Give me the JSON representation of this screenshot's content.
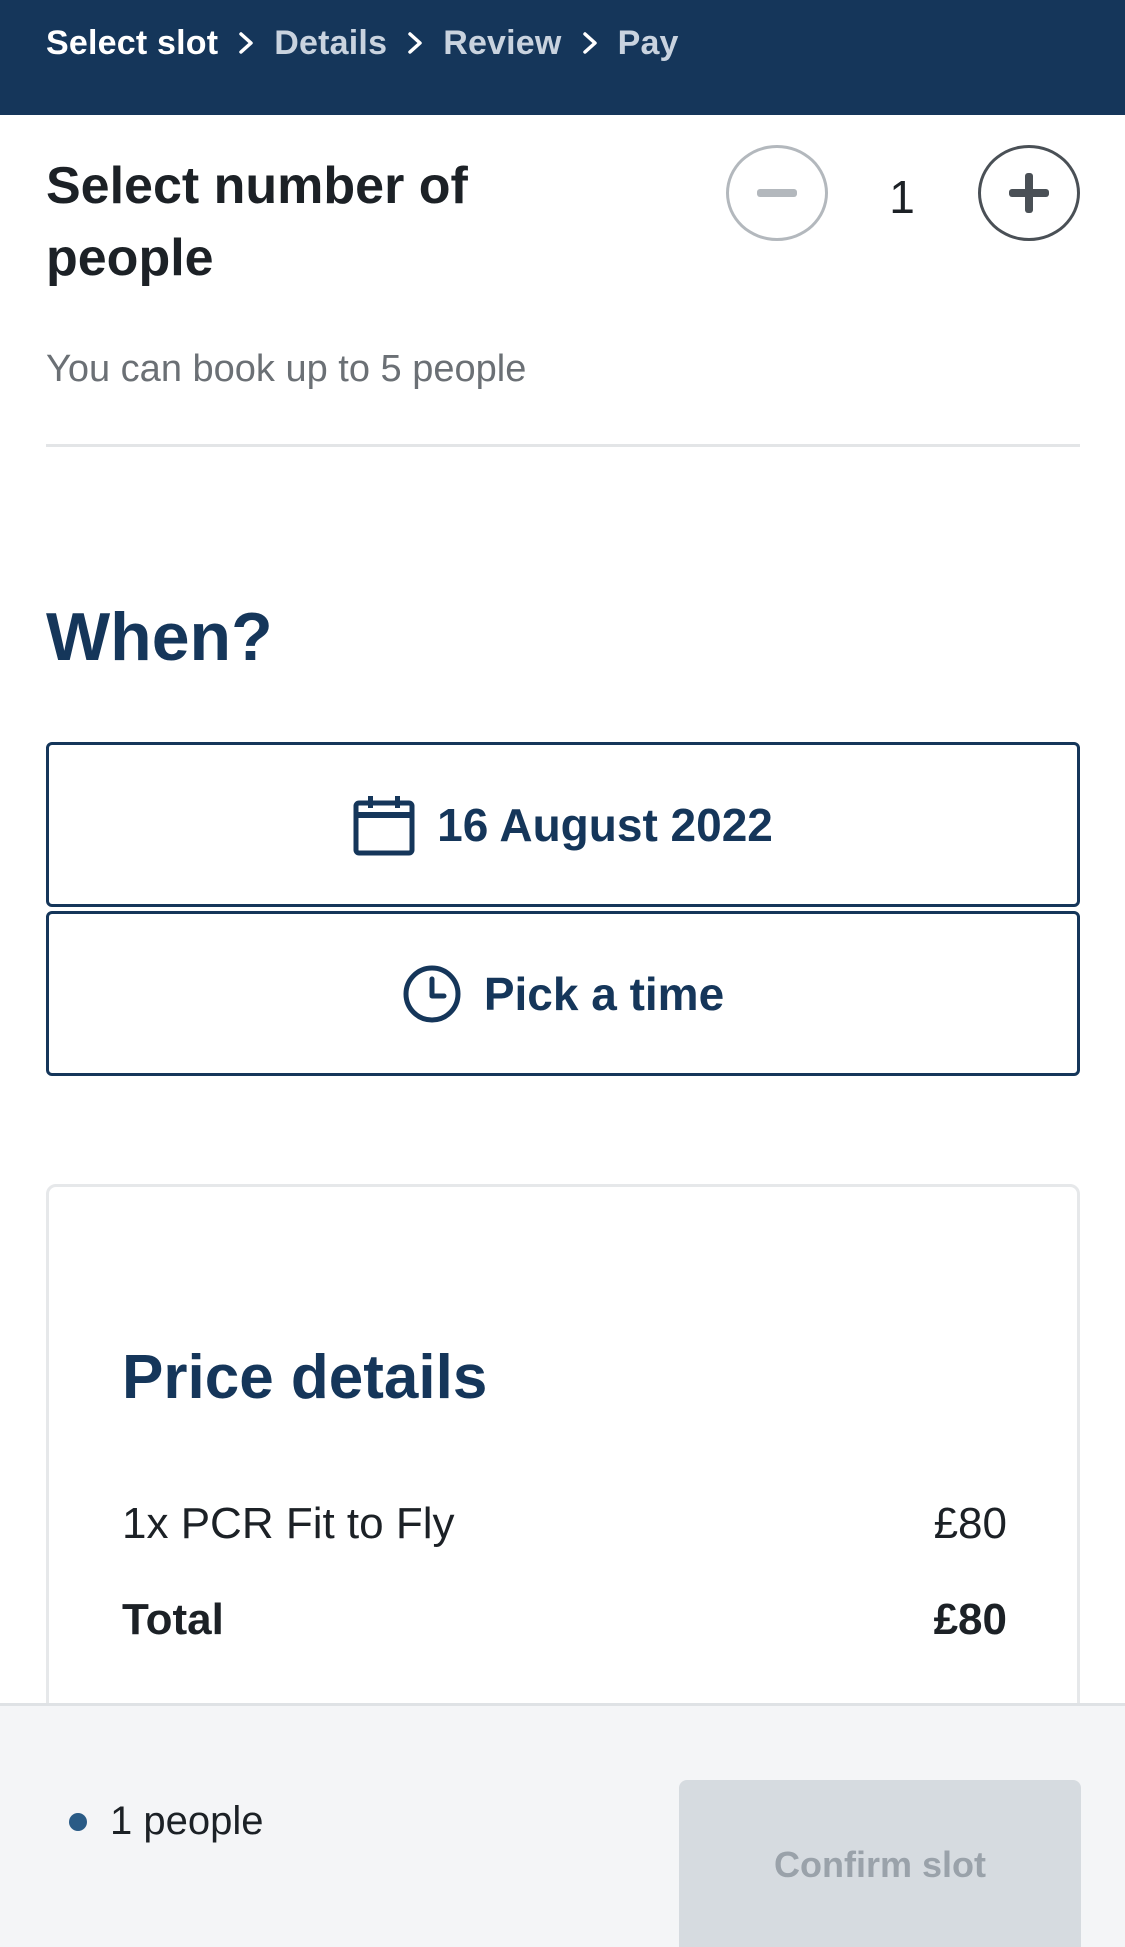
{
  "breadcrumb": {
    "steps": [
      "Select slot",
      "Details",
      "Review",
      "Pay"
    ]
  },
  "people": {
    "title": "Select number of people",
    "count": "1",
    "limit_text": "You can book up to 5 people"
  },
  "when": {
    "heading": "When?",
    "date_label": "16 August 2022",
    "time_label": "Pick a time"
  },
  "price": {
    "title": "Price details",
    "item_label": "1x PCR Fit to Fly",
    "item_price": "£80",
    "total_label": "Total",
    "total_price": "£80"
  },
  "footer": {
    "people_summary": "1 people",
    "confirm_label": "Confirm slot"
  },
  "colors": {
    "brand_navy": "#15365a",
    "disabled_button": "#d6dbe0",
    "dot": "#2a5b86"
  }
}
